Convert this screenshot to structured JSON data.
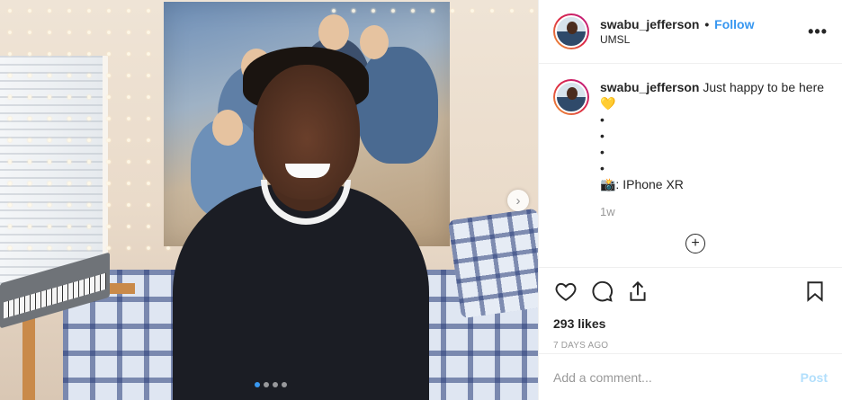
{
  "post": {
    "username": "swabu_jefferson",
    "separator": "•",
    "follow_label": "Follow",
    "location": "UMSL",
    "more_label": "•••"
  },
  "caption": {
    "username": "swabu_jefferson",
    "text": "Just happy to be here 💛",
    "bullets": [
      "•",
      "•",
      "•",
      "•"
    ],
    "camera_line": "📸: IPhone XR",
    "time": "1w",
    "load_more_label": "+"
  },
  "actions": {
    "like_icon": "heart-icon",
    "comment_icon": "comment-icon",
    "share_icon": "share-icon",
    "save_icon": "bookmark-icon",
    "likes": "293 likes",
    "date": "7 DAYS AGO"
  },
  "comment_box": {
    "placeholder": "Add a comment...",
    "post_label": "Post"
  },
  "carousel": {
    "next_label": "›",
    "dot_count": 4,
    "active_index": 0
  },
  "colors": {
    "accent": "#3897f0",
    "post_disabled": "#b2dffc",
    "muted": "#999999",
    "text": "#262626"
  }
}
